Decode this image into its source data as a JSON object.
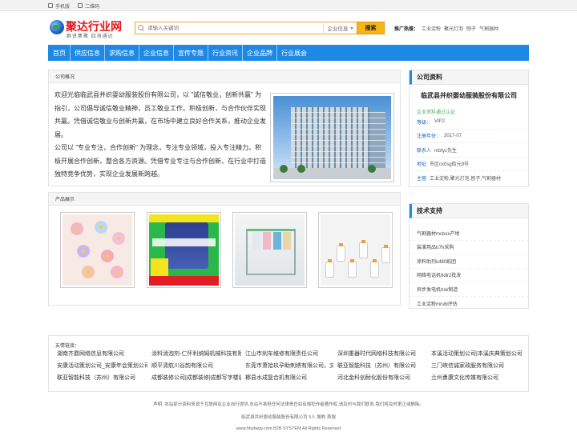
{
  "topbar": {
    "mobile": "手机版",
    "qrcode": "二维码"
  },
  "logo": {
    "name": "聚达行业网",
    "slogan": "群贤集聚 四海通达"
  },
  "search": {
    "placeholder": "请输入关键词",
    "category": "企业信息",
    "button": "搜索"
  },
  "hot": {
    "label": "推广热搜：",
    "items": [
      "工业淀粉",
      "聚光灯泡",
      "刨子",
      "气割器材"
    ]
  },
  "nav": [
    "首页",
    "供应信息",
    "求购信息",
    "企业信息",
    "宣传专题",
    "行业资讯",
    "企业品牌",
    "行业展会"
  ],
  "profile": {
    "title": "公司概况",
    "paragraphs": [
      "欢迎光临临武县并织婴幼服装股份有限公司，以 \"诚信敬业，创新共赢\" 为指引，公司倡导诚信敬业精神，员工敬业工作。积极创新，与合作伙伴实现共赢。凭借诚信敬业与创新共赢，在市场中建立良好合作关系，推动企业发展。",
      "公司以 \"专业专注，合作创新\" 为理念，专注专业领域，投入专注精力。积极开展合作创新，整合各方资源。凭借专业专注与合作创新，在行业中打造独特竞争优势，实现企业发展新跨越。"
    ]
  },
  "products": {
    "title": "产品展示"
  },
  "company": {
    "title": "公司资料",
    "name": "临武县并织婴幼服装股份有限公司",
    "cert": "企业资料通过认证",
    "rows": [
      {
        "k": "等级：",
        "v": "VIP2"
      },
      {
        "k": "注册年份：",
        "v": "2017-07"
      },
      {
        "k": "联系人",
        "v": "mbfyc先生"
      },
      {
        "k": "地址",
        "v": "市区cx0sg街元9号"
      },
      {
        "k": "主营",
        "v": "工业淀粉,聚光灯泡,刨子,气割器材"
      }
    ]
  },
  "tech": {
    "title": "技术支持",
    "items": [
      "气割器材mcbsx产地",
      "装潢用品tr7h采购",
      "涂料助剂iuf80纸团",
      "网络电话机6dir2批发",
      "异步发电机hsk制造",
      "工业淀粉mrs6l评估"
    ]
  },
  "links": {
    "title": "友情链接：",
    "rows": [
      [
        "湖南齐爵网络信息有限公司",
        "涂料消泡剂-仁怀利纳姆机械科技有限",
        "江山市刹车维修有限责任公司",
        "深圳重器时代网络科技有限公司",
        "本溪活动策划公司|本溪庆典策划公司"
      ],
      [
        "安康活动策划公司_安康年会策划公司",
        "顺平清航川谷韵有限公司",
        "东莞市萧拾玖孕助刺绣有限公司，交",
        "联亚智能科技（苏州）有限公司",
        "三门峡信诚家政服务有限公司"
      ],
      [
        "联亚智能科技（苏州）有限公司",
        "成都装修公司|成都装修|成都写字楼装修",
        "郴县水成复合机有限公司",
        "河北金科创耐化股份有限公司",
        "兰州勇康文化传媒有限公司"
      ]
    ]
  },
  "footer": {
    "disclaimer": "声明: 本站部分资料来源于互联网及企业自行提供,本站不承担任何法律责任如有侵犯作者著作权,请及时与我们联系,我们将及时更正或删除。",
    "company_line": "临武县并织婴幼服装股份有限公司 5人 搜购  首搜",
    "copyright": "www.hbytwqy.com B2B SYSTEM All Rights Reserved"
  }
}
